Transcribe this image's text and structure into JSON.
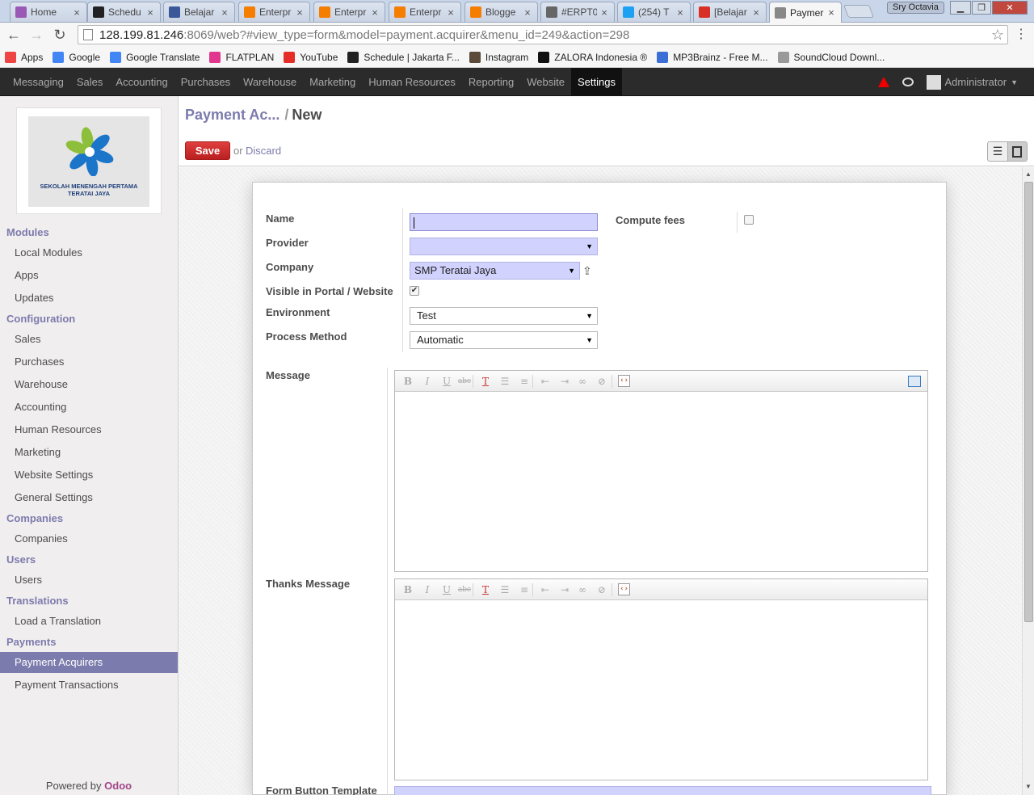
{
  "browser": {
    "tabs": [
      {
        "title": "Home",
        "icon": "page-icon",
        "color": "#9b59b6"
      },
      {
        "title": "Schedu",
        "icon": "site-icon",
        "color": "#222222"
      },
      {
        "title": "Belajar",
        "icon": "facebook-icon",
        "color": "#3b5998"
      },
      {
        "title": "Enterpr",
        "icon": "blogger-icon",
        "color": "#f57d00"
      },
      {
        "title": "Enterpr",
        "icon": "blogger-icon",
        "color": "#f57d00"
      },
      {
        "title": "Enterpr",
        "icon": "blogger-icon",
        "color": "#f57d00"
      },
      {
        "title": "Blogge",
        "icon": "blogger-icon",
        "color": "#f57d00"
      },
      {
        "title": "#ERPT0",
        "icon": "globe-icon",
        "color": "#666666"
      },
      {
        "title": "(254) T",
        "icon": "twitter-icon",
        "color": "#1da1f2"
      },
      {
        "title": "[Belajar",
        "icon": "gmail-icon",
        "color": "#d93025"
      },
      {
        "title": "Paymer",
        "icon": "page-icon",
        "color": "#888888"
      }
    ],
    "profile_name": "Sry Octavia",
    "url_host": "128.199.81.246",
    "url_rest": ":8069/web?#view_type=form&model=payment.acquirer&menu_id=249&action=298",
    "bookmarks": [
      {
        "label": "Apps",
        "icon": "apps-grid-icon",
        "color": "#e44"
      },
      {
        "label": "Google",
        "icon": "google-icon",
        "color": "#4285f4"
      },
      {
        "label": "Google Translate",
        "icon": "translate-icon",
        "color": "#4285f4"
      },
      {
        "label": "FLATPLAN",
        "icon": "heart-icon",
        "color": "#e0368d"
      },
      {
        "label": "YouTube",
        "icon": "youtube-icon",
        "color": "#e52d27"
      },
      {
        "label": "Schedule | Jakarta F...",
        "icon": "site-icon",
        "color": "#222222"
      },
      {
        "label": "Instagram",
        "icon": "instagram-icon",
        "color": "#5b4a3a"
      },
      {
        "label": "ZALORA Indonesia ®",
        "icon": "zalora-icon",
        "color": "#111111"
      },
      {
        "label": "MP3Brainz - Free M...",
        "icon": "music-icon",
        "color": "#3b6fd6"
      },
      {
        "label": "SoundCloud Downl...",
        "icon": "page-icon",
        "color": "#999999"
      }
    ]
  },
  "odoo": {
    "menu": [
      "Messaging",
      "Sales",
      "Accounting",
      "Purchases",
      "Warehouse",
      "Marketing",
      "Human Resources",
      "Reporting",
      "Website",
      "Settings"
    ],
    "active_menu": "Settings",
    "user": "Administrator",
    "logo_text": "SEKOLAH MENENGAH PERTAMA TERATAI JAYA",
    "sidebar": {
      "modules": {
        "title": "Modules",
        "items": [
          "Local Modules",
          "Apps",
          "Updates"
        ]
      },
      "configuration": {
        "title": "Configuration",
        "items": [
          "Sales",
          "Purchases",
          "Warehouse",
          "Accounting",
          "Human Resources",
          "Marketing",
          "Website Settings",
          "General Settings"
        ]
      },
      "companies": {
        "title": "Companies",
        "items": [
          "Companies"
        ]
      },
      "users": {
        "title": "Users",
        "items": [
          "Users"
        ]
      },
      "translations": {
        "title": "Translations",
        "items": [
          "Load a Translation"
        ]
      },
      "payments": {
        "title": "Payments",
        "items": [
          "Payment Acquirers",
          "Payment Transactions"
        ]
      }
    },
    "powered_by": "Powered by",
    "powered_brand": "Odoo",
    "breadcrumb": {
      "parent": "Payment Ac...",
      "sep": "/",
      "current": "New"
    },
    "buttons": {
      "save": "Save",
      "or": "or",
      "discard": "Discard"
    },
    "form": {
      "name": {
        "label": "Name",
        "value": ""
      },
      "provider": {
        "label": "Provider",
        "value": ""
      },
      "company": {
        "label": "Company",
        "value": "SMP Teratai Jaya"
      },
      "visible_portal": {
        "label": "Visible in Portal / Website",
        "checked": true
      },
      "environment": {
        "label": "Environment",
        "value": "Test"
      },
      "process_method": {
        "label": "Process Method",
        "value": "Automatic"
      },
      "compute_fees": {
        "label": "Compute fees",
        "checked": false
      },
      "message": {
        "label": "Message"
      },
      "thanks_message": {
        "label": "Thanks Message"
      },
      "form_button_template": {
        "label": "Form Button Template"
      }
    },
    "editor_toolbar": [
      "B",
      "I",
      "U",
      "abc",
      "T",
      "list-bullet",
      "list-number",
      "outdent",
      "indent",
      "link",
      "unlink",
      "source"
    ]
  }
}
